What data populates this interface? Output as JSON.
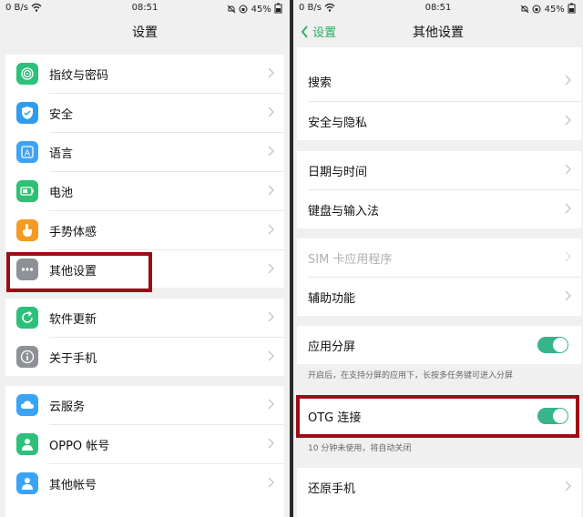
{
  "status": {
    "net_speed": "0 B/s",
    "time": "08:51",
    "battery": "45%"
  },
  "left": {
    "title": "设置",
    "groups": [
      [
        {
          "label": "指纹与密码",
          "icon": "fingerprint-icon",
          "color": "#2dc07a"
        },
        {
          "label": "安全",
          "icon": "shield-icon",
          "color": "#2e9cf0"
        },
        {
          "label": "语言",
          "icon": "language-icon",
          "color": "#3fa3f5"
        },
        {
          "label": "电池",
          "icon": "battery-icon",
          "color": "#2fc073"
        },
        {
          "label": "手势体感",
          "icon": "gesture-icon",
          "color": "#f59a23"
        },
        {
          "label": "其他设置",
          "icon": "more-icon",
          "color": "#8e9297"
        }
      ],
      [
        {
          "label": "软件更新",
          "icon": "update-icon",
          "color": "#2dc07a"
        },
        {
          "label": "关于手机",
          "icon": "info-icon",
          "color": "#8e9297"
        }
      ],
      [
        {
          "label": "云服务",
          "icon": "cloud-icon",
          "color": "#3aa3f5"
        },
        {
          "label": "OPPO 帐号",
          "icon": "account-icon",
          "color": "#2dc07a"
        },
        {
          "label": "其他帐号",
          "icon": "other-account-icon",
          "color": "#3aa3f5"
        }
      ]
    ]
  },
  "right": {
    "back_label": "设置",
    "title": "其他设置",
    "items": {
      "search": "搜索",
      "security_privacy": "安全与隐私",
      "date_time": "日期与时间",
      "keyboard_input": "键盘与输入法",
      "sim_apps": "SIM 卡应用程序",
      "accessibility": "辅助功能",
      "split_screen": "应用分屏",
      "split_screen_hint": "开启后，在支持分屏的应用下，长按多任务键可进入分屏",
      "otg": "OTG 连接",
      "otg_hint": "10 分钟未使用，将自动关闭",
      "reset": "还原手机"
    },
    "toggles": {
      "split_screen_on": true,
      "otg_on": true
    },
    "accent": "#38b48b",
    "highlight": "#9b0d16"
  }
}
